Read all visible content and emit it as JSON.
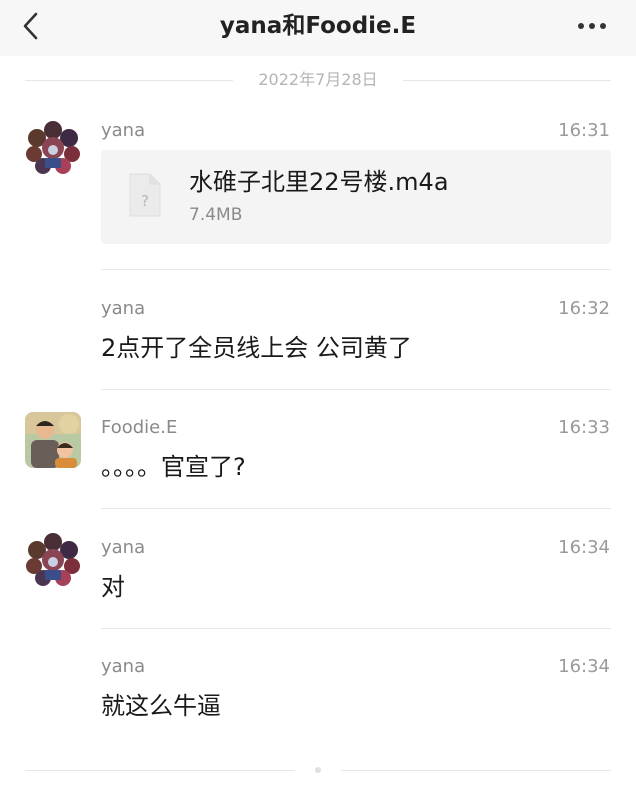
{
  "header": {
    "title": "yana和Foodie.E",
    "back_icon": "chevron-left-icon",
    "more_icon": "more-horizontal-icon"
  },
  "date_divider": "2022年7月28日",
  "messages": [
    {
      "sender": "yana",
      "time": "16:31",
      "file": {
        "name": "水碓子北里22号楼.m4a",
        "size": "7.4MB",
        "icon": "unknown-file-icon",
        "icon_glyph": "?"
      }
    },
    {
      "sender": "yana",
      "time": "16:32",
      "text": "2点开了全员线上会 公司黄了"
    },
    {
      "sender": "Foodie.E",
      "time": "16:33",
      "text": "。。。。官宣了?"
    },
    {
      "sender": "yana",
      "time": "16:34",
      "text": "对"
    },
    {
      "sender": "yana",
      "time": "16:34",
      "text": "就这么牛逼"
    }
  ],
  "colors": {
    "header_bg": "#f7f7f7",
    "divider": "#e8e8e8",
    "file_card_bg": "#f4f4f4",
    "muted_text": "#8a8a8a"
  }
}
